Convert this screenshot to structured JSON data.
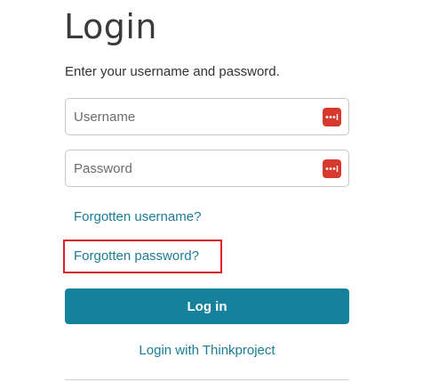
{
  "page": {
    "title": "Login",
    "subtitle": "Enter your username and password."
  },
  "form": {
    "username": {
      "placeholder": "Username",
      "value": ""
    },
    "password": {
      "placeholder": "Password",
      "value": ""
    },
    "password_manager_icon": "password-manager-dots-icon",
    "login_button_label": "Log in"
  },
  "links": {
    "forgotten_username": "Forgotten username?",
    "forgotten_password": "Forgotten password?",
    "login_with_thinkproject": "Login with Thinkproject"
  },
  "colors": {
    "accent": "#16819a",
    "link": "#1b7c96",
    "highlight": "#e01e2a",
    "password_manager_icon": "#d7392c"
  }
}
